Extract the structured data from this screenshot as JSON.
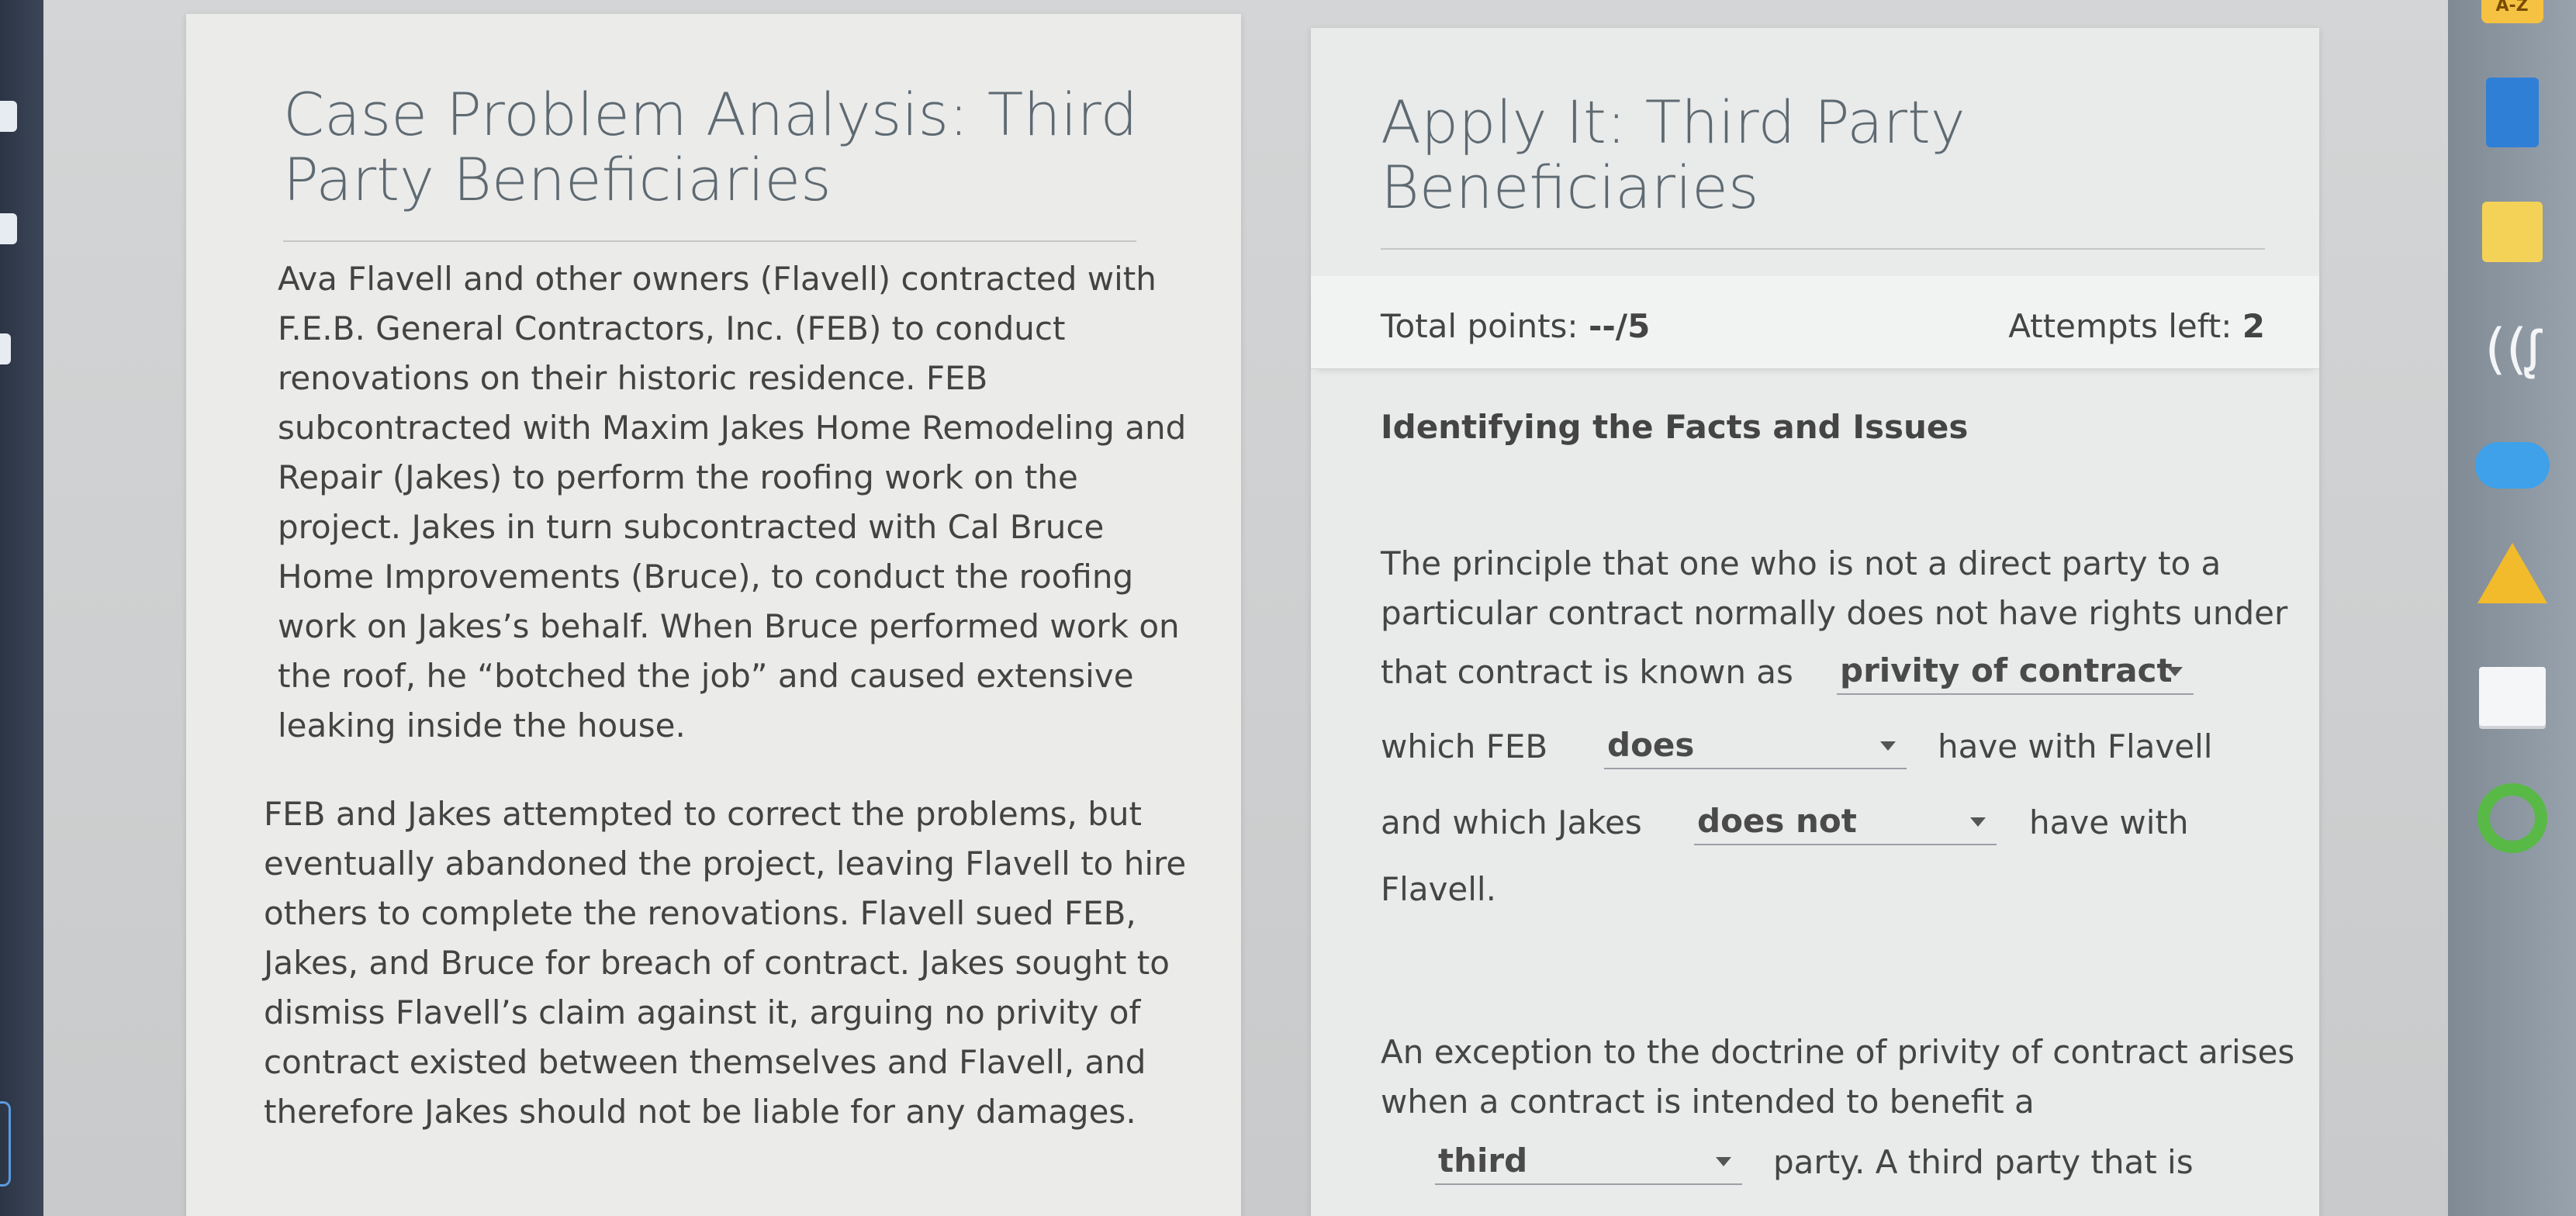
{
  "left_panel": {
    "title_line1": "Case Problem Analysis: Third",
    "title_line2": "Party Beneficiaries",
    "paragraph1_lines": [
      "Ava Flavell and other owners (Flavell) contracted with",
      "F.E.B. General Contractors, Inc. (FEB) to conduct",
      "renovations on their historic residence. FEB",
      "subcontracted with Maxim Jakes Home Remodeling and",
      "Repair (Jakes) to perform the roofing work on the",
      "project. Jakes in turn subcontracted with Cal Bruce",
      "Home Improvements (Bruce), to conduct the roofing",
      "work on Jakes’s behalf. When Bruce performed work on",
      "the roof, he “botched the job” and caused extensive",
      "leaking inside the house."
    ],
    "paragraph2_lines": [
      "FEB and Jakes attempted to correct the problems, but",
      "eventually abandoned the project, leaving Flavell to hire",
      "others to complete the renovations. Flavell sued FEB,",
      "Jakes, and Bruce for breach of contract. Jakes sought to",
      "dismiss Flavell’s claim against it, arguing no privity of",
      "contract existed between themselves and Flavell, and",
      "therefore Jakes should not be liable for any damages."
    ]
  },
  "right_panel": {
    "title_line1": "Apply It: Third Party",
    "title_line2": "Beneficiaries",
    "total_points_label": "Total points: ",
    "total_points_value": "--/5",
    "attempts_label": "Attempts left: ",
    "attempts_value": "2",
    "section_heading": "Identifying the Facts and Issues",
    "q1": {
      "line1": "The principle that one who is not a direct party to a",
      "line2": "particular contract normally does not have rights under",
      "line3": "that contract is known as",
      "dropdown1": "privity of contract",
      "line4_pre": "which FEB",
      "dropdown2": "does",
      "line4_post": "have with Flavell",
      "line5_pre": "and which Jakes",
      "dropdown3": "does not",
      "line5_post": "have with",
      "line6": "Flavell."
    },
    "q2": {
      "line1": "An exception to the doctrine of privity of contract arises",
      "line2": "when a contract is intended to benefit a",
      "dropdown1": "third",
      "line3_post": "party. A third party that is"
    }
  },
  "toolbar": {
    "az_label": "A-Z",
    "speech_glyph": "((ᶘ"
  },
  "colors": {
    "title": "#5e6a72",
    "text": "#434343",
    "panel": "#ebebea"
  }
}
